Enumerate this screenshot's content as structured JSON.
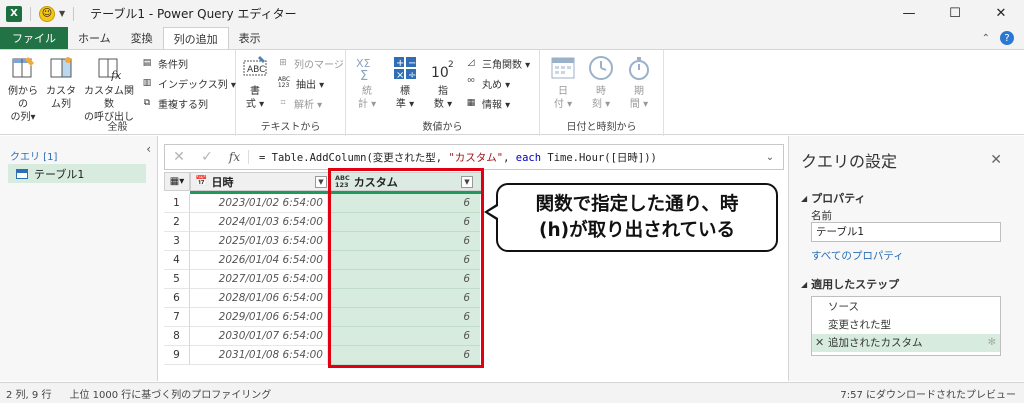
{
  "titlebar": {
    "app_badge": "X",
    "title": "テーブル1 - Power Query エディター",
    "minimize": "—",
    "maximize": "☐",
    "close": "✕"
  },
  "tabs": [
    {
      "label": "ファイル"
    },
    {
      "label": "ホーム"
    },
    {
      "label": "変換"
    },
    {
      "label": "列の追加"
    },
    {
      "label": "表示"
    }
  ],
  "ribbon": {
    "general": {
      "label": "全般",
      "example_col": [
        "例からの",
        "の列▾"
      ],
      "custom_col": [
        "カスタ",
        "ム列"
      ],
      "invoke_fn": [
        "カスタム関数",
        "の呼び出し"
      ],
      "conditional": "条件列",
      "index": "インデックス列 ▾",
      "duplicate": "重複する列"
    },
    "text": {
      "label": "テキストから",
      "format": [
        "書",
        "式 ▾"
      ],
      "merge": "列のマージ",
      "extract": "抽出 ▾",
      "parse": "解析 ▾"
    },
    "number": {
      "label": "数値から",
      "stats": [
        "統",
        "計 ▾"
      ],
      "standard": [
        "標",
        "準 ▾"
      ],
      "scientific": [
        "指",
        "数 ▾"
      ],
      "trig": "三角関数 ▾",
      "round": "丸め ▾",
      "info": "情報 ▾"
    },
    "datetime": {
      "label": "日付と時刻から",
      "date": [
        "日",
        "付 ▾"
      ],
      "time": [
        "時",
        "刻 ▾"
      ],
      "duration": [
        "期",
        "間 ▾"
      ]
    }
  },
  "query_pane": {
    "header": "クエリ [1]",
    "items": [
      {
        "label": "テーブル1"
      }
    ]
  },
  "formula": {
    "prefix": "= Table.AddColumn(変更された型, ",
    "str": "\"カスタム\"",
    "mid": ", ",
    "kw": "each",
    "suffix": " Time.Hour([日時]))"
  },
  "grid": {
    "columns": [
      {
        "label": "日時",
        "type_icon": "calendar-clock-icon"
      },
      {
        "label": "カスタム",
        "type_icon": "abc123-icon"
      }
    ],
    "rows": [
      {
        "n": "1",
        "date": "2023/01/02 6:54:00",
        "custom": "6"
      },
      {
        "n": "2",
        "date": "2024/01/03 6:54:00",
        "custom": "6"
      },
      {
        "n": "3",
        "date": "2025/01/03 6:54:00",
        "custom": "6"
      },
      {
        "n": "4",
        "date": "2026/01/04 6:54:00",
        "custom": "6"
      },
      {
        "n": "5",
        "date": "2027/01/05 6:54:00",
        "custom": "6"
      },
      {
        "n": "6",
        "date": "2028/01/06 6:54:00",
        "custom": "6"
      },
      {
        "n": "7",
        "date": "2029/01/06 6:54:00",
        "custom": "6"
      },
      {
        "n": "8",
        "date": "2030/01/07 6:54:00",
        "custom": "6"
      },
      {
        "n": "9",
        "date": "2031/01/08 6:54:00",
        "custom": "6"
      }
    ]
  },
  "callout": {
    "line1": "関数で指定した通り、時",
    "line2": "(h)が取り出されている"
  },
  "settings": {
    "title": "クエリの設定",
    "properties": "プロパティ",
    "name_label": "名前",
    "name_value": "テーブル1",
    "all_props": "すべてのプロパティ",
    "applied_steps": "適用したステップ",
    "steps": [
      {
        "label": "ソース"
      },
      {
        "label": "変更された型"
      },
      {
        "label": "追加されたカスタム"
      }
    ]
  },
  "statusbar": {
    "left": "2 列, 9 行",
    "profiling": "上位 1000 行に基づく列のプロファイリング",
    "right": "7:57 にダウンロードされたプレビュー"
  },
  "colors": {
    "excel_green": "#217346",
    "selection_green": "#d7ecdf",
    "highlight_red": "#e00012"
  }
}
